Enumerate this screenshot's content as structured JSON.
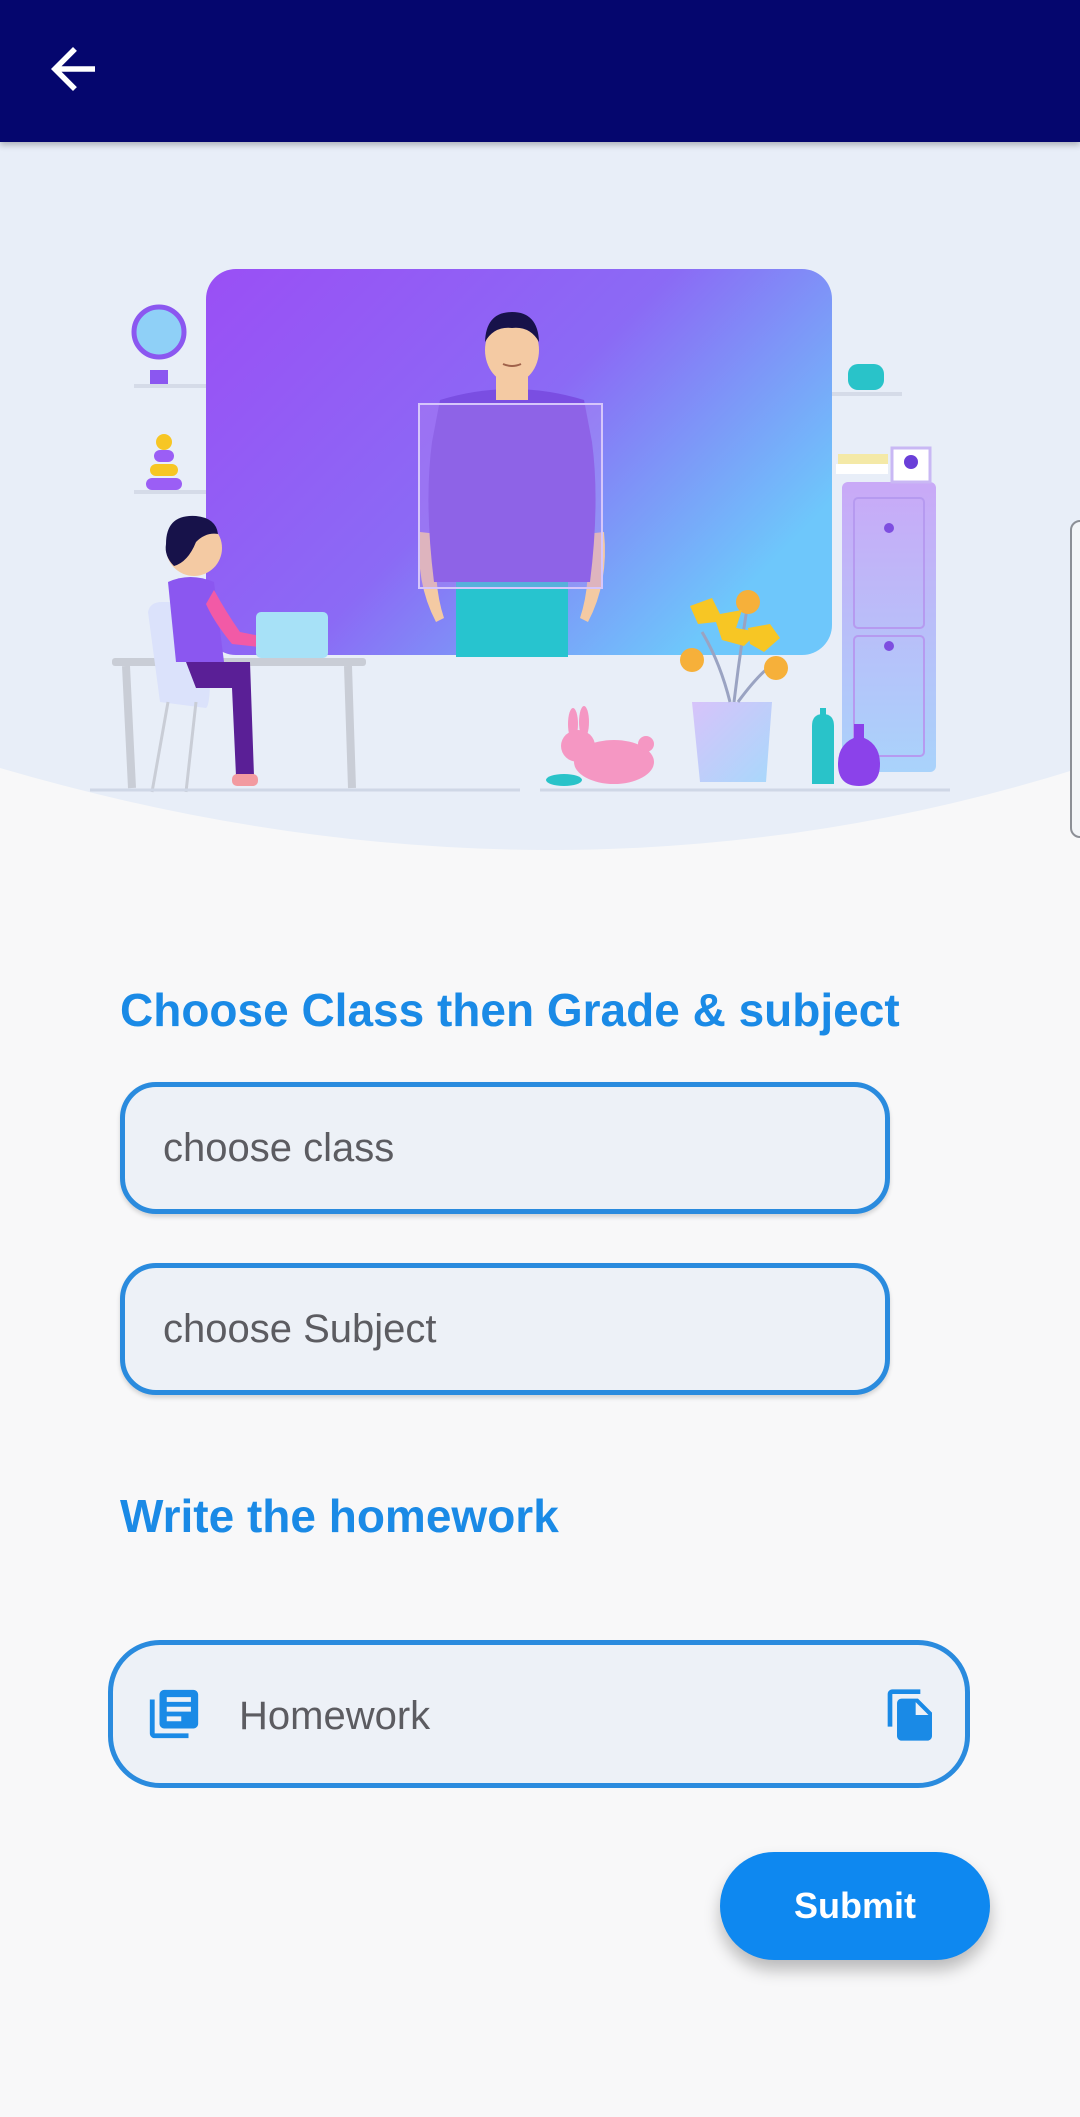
{
  "appbar": {
    "back_icon": "arrow-left-icon"
  },
  "illustration": {
    "name": "online-class-illustration"
  },
  "form": {
    "class_section_title": "Choose Class then Grade & subject",
    "class_placeholder": "choose class",
    "subject_placeholder": "choose Subject",
    "homework_section_title": "Write the homework",
    "homework_placeholder": "Homework",
    "homework_lead_icon": "article-icon",
    "homework_trail_icon": "file-copy-icon",
    "submit_label": "Submit"
  },
  "colors": {
    "appbar": "#05066e",
    "accent": "#1a8ae6",
    "button": "#0e88f0",
    "field_bg": "#edf1f7"
  }
}
